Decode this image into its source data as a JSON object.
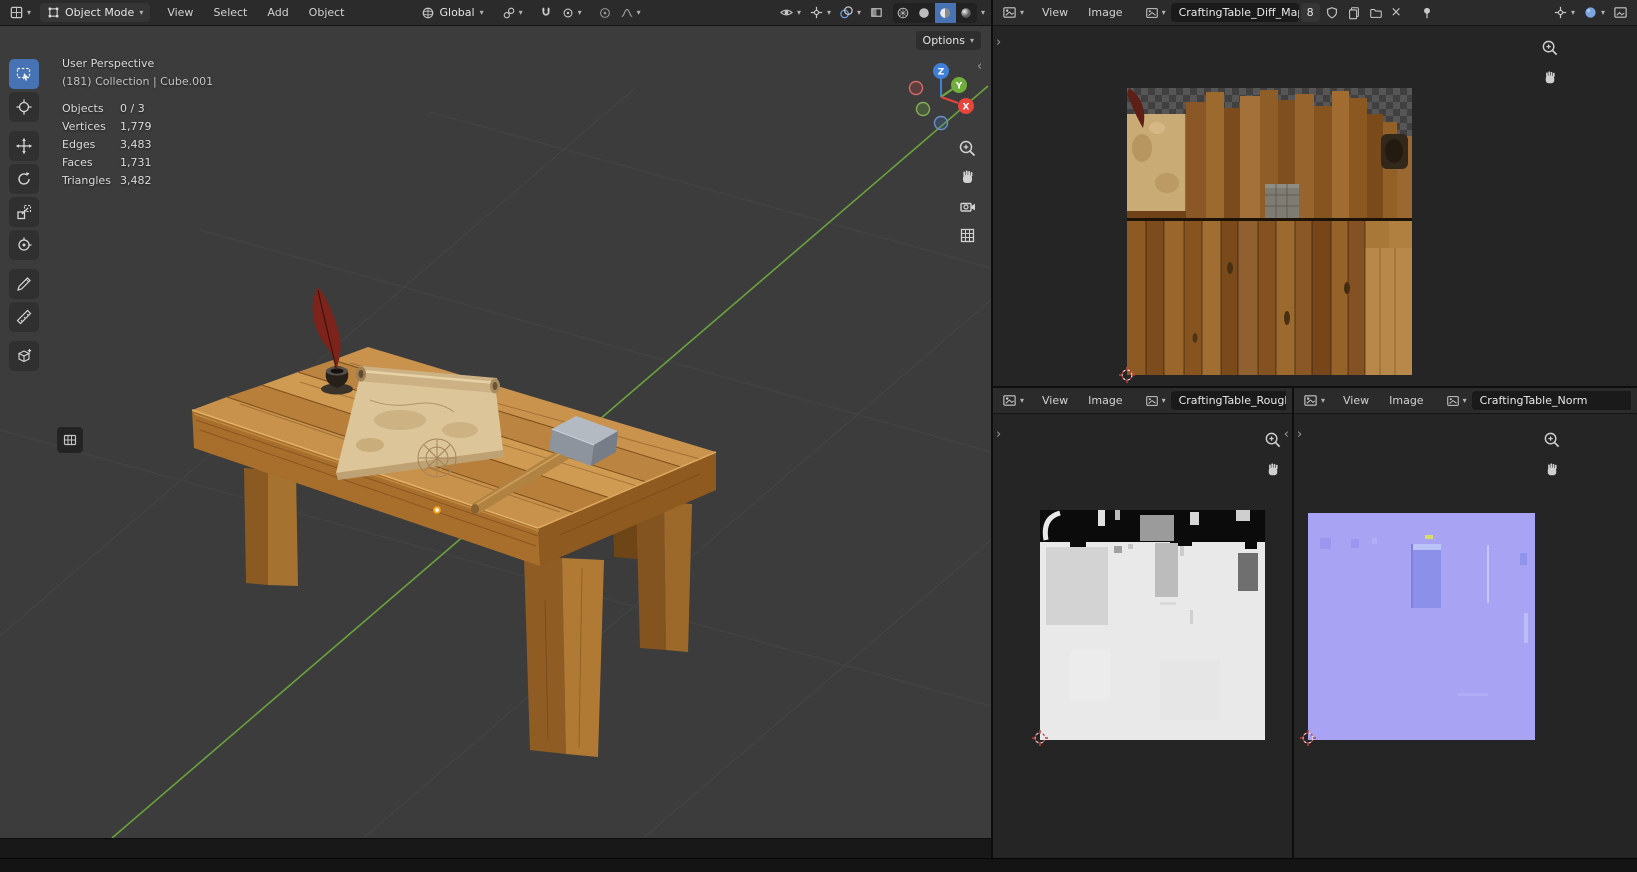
{
  "colors": {
    "accent_blue": "#4772b3",
    "axis_x_red": "#e8443c",
    "axis_y_green": "#6fae3b",
    "axis_z_blue": "#3f7fd8",
    "viewport_bg": "#3c3c3c",
    "header_bg": "#2b2b2b",
    "editor_bg": "#252525",
    "normal_map_base": "#a8a4f3"
  },
  "icons": {
    "dropdown": "▾",
    "close": "×",
    "chevron_left": "‹",
    "chevron_right": "›"
  },
  "viewport": {
    "header": {
      "mode": "Object Mode",
      "menus": [
        "View",
        "Select",
        "Add",
        "Object"
      ],
      "orientation": "Global"
    },
    "options_label": "Options",
    "overlay": {
      "perspective": "User Perspective",
      "collection": "(181) Collection | Cube.001",
      "stats": [
        {
          "label": "Objects",
          "value": "0 / 3"
        },
        {
          "label": "Vertices",
          "value": "1,779"
        },
        {
          "label": "Edges",
          "value": "3,483"
        },
        {
          "label": "Faces",
          "value": "1,731"
        },
        {
          "label": "Triangles",
          "value": "3,482"
        }
      ]
    },
    "gizmo": {
      "x": "X",
      "y": "Y",
      "z": "Z"
    }
  },
  "editors": {
    "diffuse": {
      "menu_view": "View",
      "menu_image": "Image",
      "image_name": "CraftingTable_Diff_Map",
      "users": "8"
    },
    "rough": {
      "menu_view": "View",
      "menu_image": "Image",
      "image_name": "CraftingTable_Rough_Ma"
    },
    "normal": {
      "menu_view": "View",
      "menu_image": "Image",
      "image_name": "CraftingTable_Norm"
    }
  }
}
